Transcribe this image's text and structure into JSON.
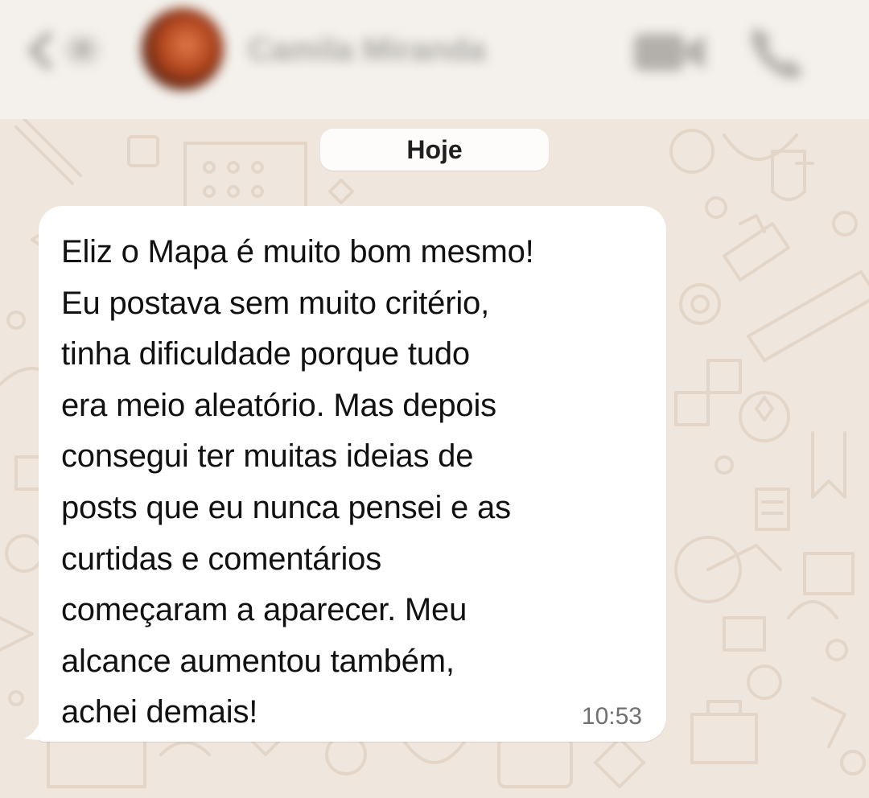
{
  "header": {
    "contact_name": "Camila Miranda",
    "unread_count": "3",
    "icons": [
      "back-chevron-icon",
      "video-call-icon",
      "phone-call-icon"
    ]
  },
  "chat": {
    "date_separator": "Hoje",
    "messages": [
      {
        "direction": "incoming",
        "text": "Eliz o Mapa é muito bom mesmo!\nEu postava sem muito critério,\ntinha dificuldade porque tudo\nera meio aleatório. Mas depois\nconsegui ter muitas ideias de\nposts que eu nunca pensei e as\ncurtidas e comentários\ncomeçaram a aparecer. Meu\nalcance aumentou também,\nachei demais!",
        "time": "10:53"
      }
    ]
  },
  "colors": {
    "wallpaper": "#efe7de",
    "doodle": "#e3d6c8",
    "bubble": "#ffffff",
    "header": "#f4f1ec"
  }
}
